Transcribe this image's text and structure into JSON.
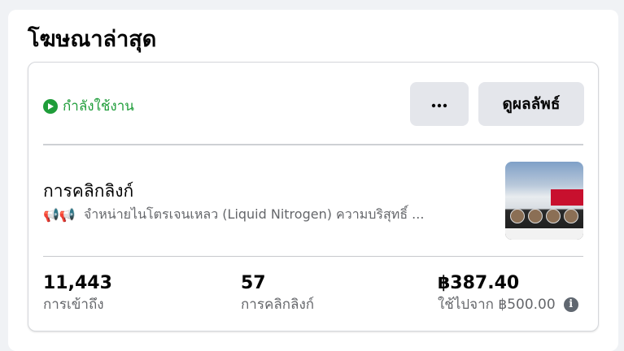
{
  "section": {
    "title": "โฆษณาล่าสุด"
  },
  "ad": {
    "status": "กำลังใช้งาน",
    "more_icon": "more-horizontal-icon",
    "results_button": "ดูผลลัพธ์",
    "objective": "การคลิกลิงก์",
    "megaphone_icons": "📢📢",
    "description": "จำหน่ายไนโตรเจนเหลว (Liquid Nitrogen) ความบริสุทธิ์ ...",
    "metrics": [
      {
        "value": "11,443",
        "label": "การเข้าถึง"
      },
      {
        "value": "57",
        "label": "การคลิกลิงก์"
      },
      {
        "value": "฿387.40",
        "label": "ใช้ไปจาก ฿500.00"
      }
    ]
  },
  "colors": {
    "status_green": "#1f9d3a",
    "button_bg": "#e4e6eb",
    "secondary_text": "#65676b"
  }
}
